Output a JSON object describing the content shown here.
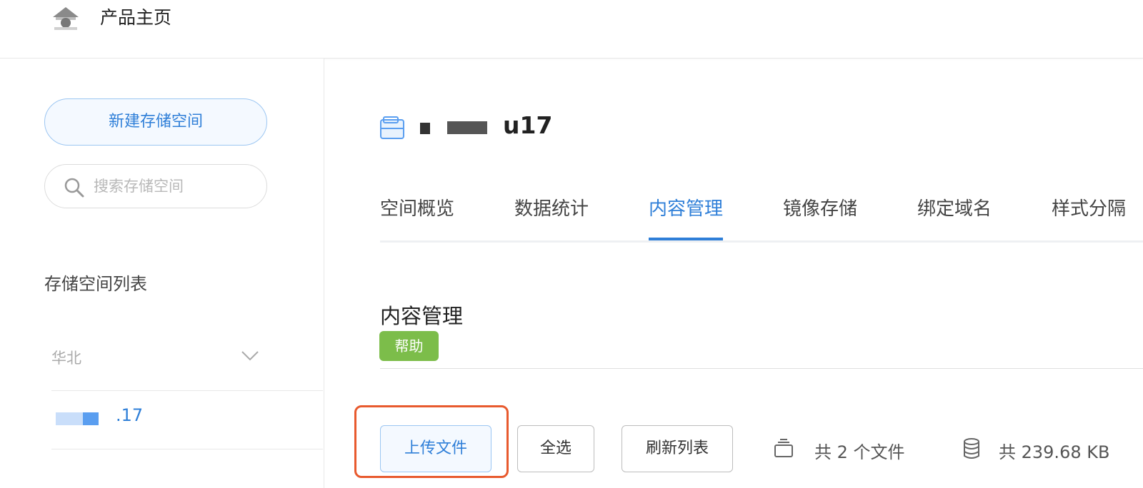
{
  "header": {
    "title": "产品主页",
    "logo_icon": "home-logo-icon"
  },
  "sidebar": {
    "new_bucket_label": "新建存储空间",
    "search_placeholder": "搜索存储空间",
    "list_title": "存储空间列表",
    "region": "华北",
    "bucket_suffix": ".17"
  },
  "main": {
    "bucket_name_suffix": "u17",
    "tabs": [
      {
        "label": "空间概览"
      },
      {
        "label": "数据统计"
      },
      {
        "label": "内容管理"
      },
      {
        "label": "镜像存储"
      },
      {
        "label": "绑定域名"
      },
      {
        "label": "样式分隔"
      }
    ],
    "active_tab": "内容管理",
    "section_title": "内容管理",
    "help_label": "帮助",
    "toolbar": {
      "upload_label": "上传文件",
      "select_all_label": "全选",
      "refresh_label": "刷新列表"
    },
    "stats": {
      "file_count": "共 2 个文件",
      "total_size": "共 239.68 KB"
    }
  },
  "colors": {
    "accent": "#2f7fd8",
    "help_green": "#7cbd4a",
    "highlight": "#e85a2e"
  }
}
